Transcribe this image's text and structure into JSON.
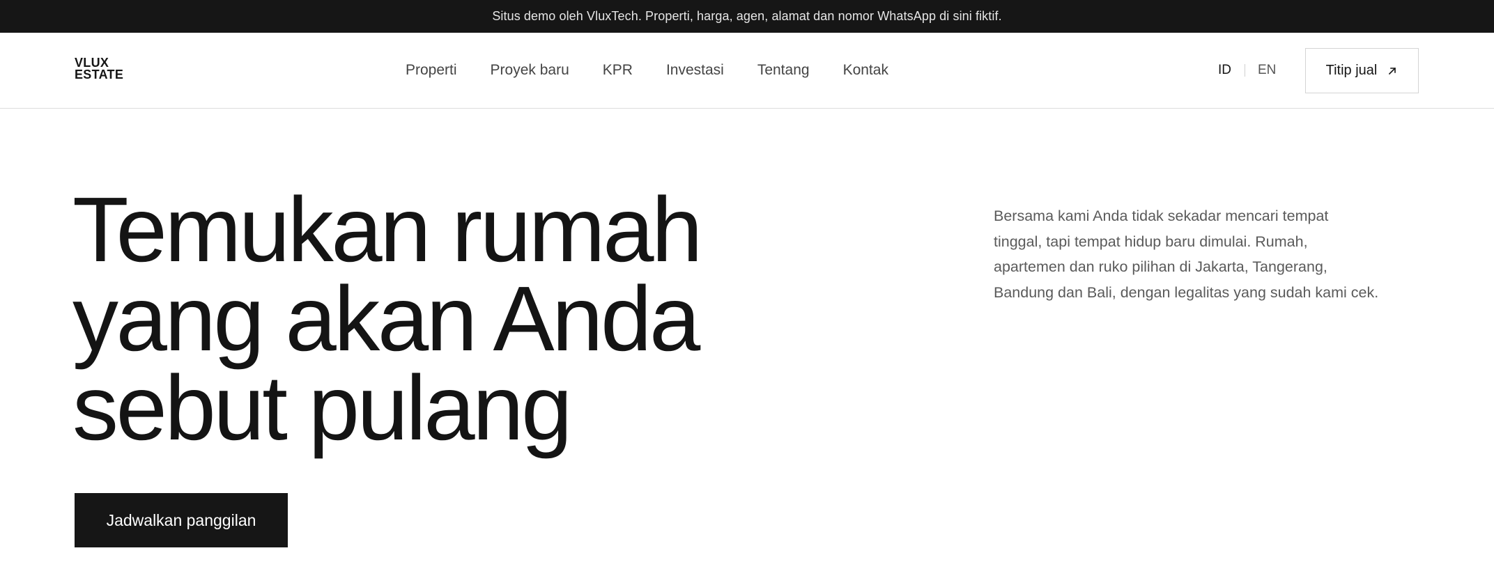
{
  "announcement": "Situs demo oleh VluxTech. Properti, harga, agen, alamat dan nomor WhatsApp di sini fiktif.",
  "logo": {
    "line1": "VLUX",
    "line2": "ESTATE"
  },
  "nav": {
    "items": [
      {
        "label": "Properti"
      },
      {
        "label": "Proyek baru"
      },
      {
        "label": "KPR"
      },
      {
        "label": "Investasi"
      },
      {
        "label": "Tentang"
      },
      {
        "label": "Kontak"
      }
    ]
  },
  "language": {
    "active": "ID",
    "other": "EN"
  },
  "header_cta": {
    "label": "Titip jual",
    "icon": "arrow-up-right-icon"
  },
  "hero": {
    "title_lines": [
      "Temukan rumah",
      "yang akan Anda",
      "sebut pulang"
    ],
    "description_lines": [
      "Bersama kami Anda tidak sekadar mencari tempat",
      "tinggal, tapi tempat hidup baru dimulai. Rumah,",
      "apartemen dan ruko pilihan di Jakarta, Tangerang,",
      "Bandung dan Bali, dengan legalitas yang sudah kami cek."
    ],
    "cta_label": "Jadwalkan panggilan"
  },
  "colors": {
    "announcement_bg": "#161616",
    "text_primary": "#151515",
    "text_muted": "#5a5a5a",
    "button_dark": "#161616",
    "border": "#d4d4d4"
  }
}
